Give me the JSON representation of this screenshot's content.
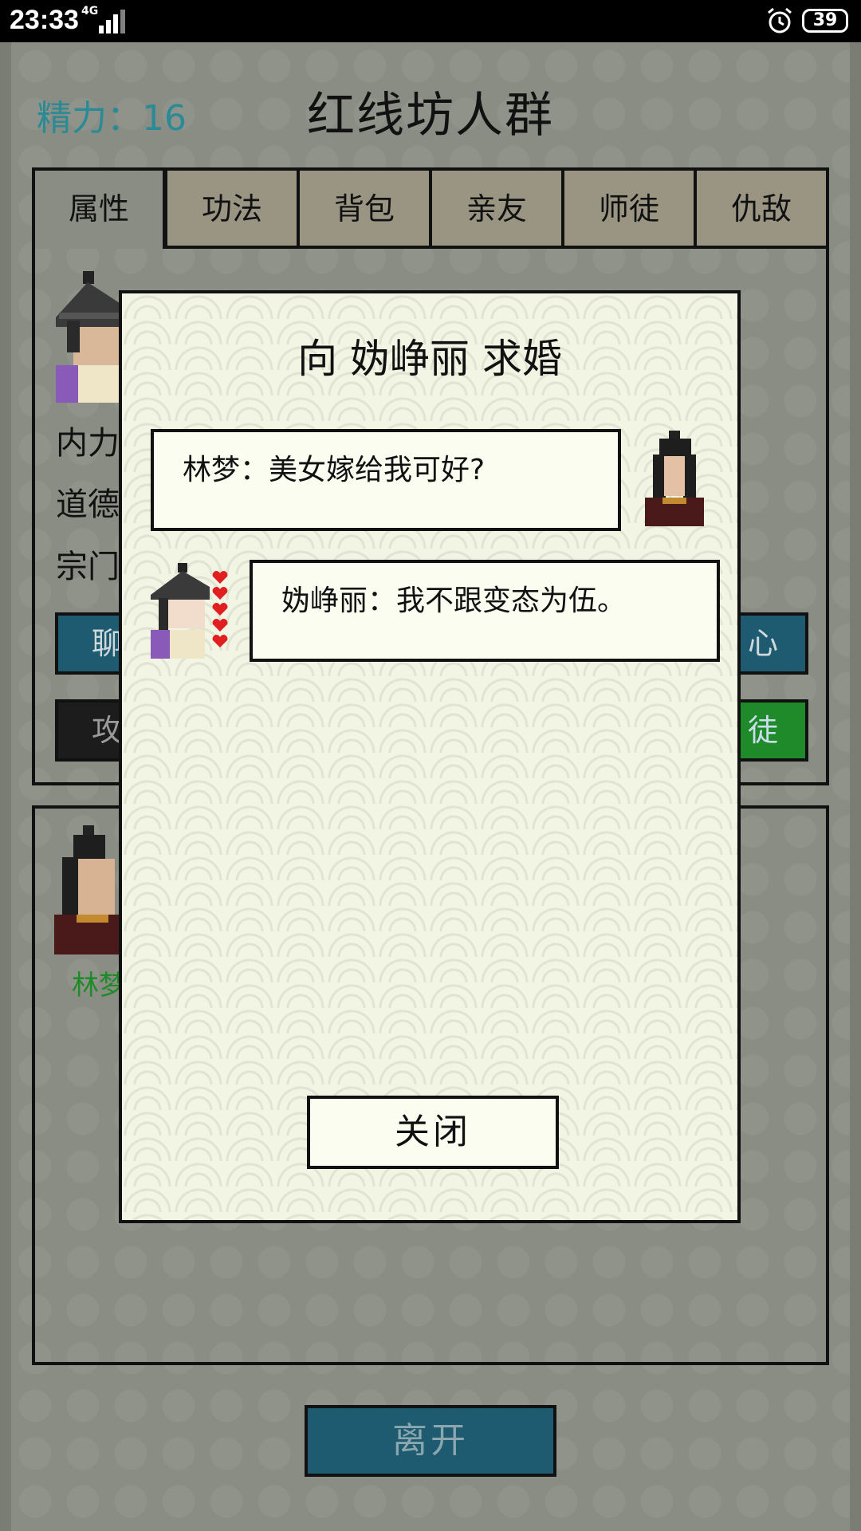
{
  "status_bar": {
    "time": "23:33",
    "network": "4G",
    "battery": "39"
  },
  "header": {
    "energy_label": "精力：16",
    "place_title": "红线坊人群"
  },
  "tabs": [
    {
      "label": "属性"
    },
    {
      "label": "功法"
    },
    {
      "label": "背包"
    },
    {
      "label": "亲友"
    },
    {
      "label": "师徒"
    },
    {
      "label": "仇敌"
    }
  ],
  "stats_partial": {
    "neili": "内力",
    "daode": "道德",
    "zongmen": "宗门"
  },
  "action_buttons_partial": {
    "chat": "聊",
    "attack": "攻",
    "heart": "心",
    "apprentice": "徒"
  },
  "list": {
    "first_name": "林梦"
  },
  "leave_button": "离开",
  "dialog": {
    "title": "向 妫峥丽 求婚",
    "line1": "林梦：美女嫁给我可好?",
    "line2": "妫峥丽：我不跟变态为伍。",
    "close_label": "关闭"
  },
  "colors": {
    "energy": "#2a8a96",
    "chat_button": "#1e5a70",
    "attack_button": "#1c1c1c",
    "apprentice_button": "#1f8a2a",
    "list_name": "#1f8a2a",
    "hearts": "#e02020"
  },
  "icons": [
    "alarm-icon",
    "signal-icon",
    "battery-icon",
    "heart-icon"
  ]
}
